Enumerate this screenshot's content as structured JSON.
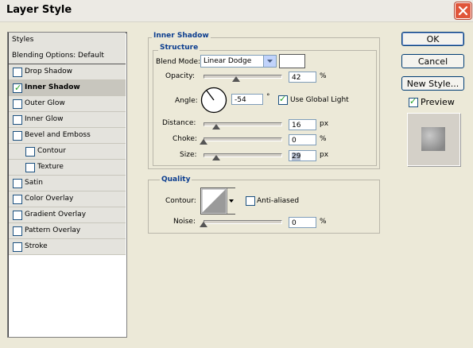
{
  "window": {
    "title": "Layer Style"
  },
  "sidebar": {
    "header": "Styles",
    "items": [
      {
        "label": "Blending Options: Default",
        "checkbox": false,
        "checked": false,
        "indent": 0
      },
      {
        "label": "Drop Shadow",
        "checkbox": true,
        "checked": false,
        "indent": 0
      },
      {
        "label": "Inner Shadow",
        "checkbox": true,
        "checked": true,
        "indent": 0,
        "selected": true
      },
      {
        "label": "Outer Glow",
        "checkbox": true,
        "checked": false,
        "indent": 0
      },
      {
        "label": "Inner Glow",
        "checkbox": true,
        "checked": false,
        "indent": 0
      },
      {
        "label": "Bevel and Emboss",
        "checkbox": true,
        "checked": false,
        "indent": 0
      },
      {
        "label": "Contour",
        "checkbox": true,
        "checked": false,
        "indent": 1
      },
      {
        "label": "Texture",
        "checkbox": true,
        "checked": false,
        "indent": 1
      },
      {
        "label": "Satin",
        "checkbox": true,
        "checked": false,
        "indent": 0
      },
      {
        "label": "Color Overlay",
        "checkbox": true,
        "checked": false,
        "indent": 0
      },
      {
        "label": "Gradient Overlay",
        "checkbox": true,
        "checked": false,
        "indent": 0
      },
      {
        "label": "Pattern Overlay",
        "checkbox": true,
        "checked": false,
        "indent": 0
      },
      {
        "label": "Stroke",
        "checkbox": true,
        "checked": false,
        "indent": 0
      }
    ]
  },
  "inner_shadow": {
    "title": "Inner Shadow",
    "structure": {
      "title": "Structure",
      "blend_mode_label": "Blend Mode:",
      "blend_mode_value": "Linear Dodge",
      "shadow_color": "#ffffff",
      "opacity_label": "Opacity:",
      "opacity_value": "42",
      "opacity_unit": "%",
      "angle_label": "Angle:",
      "angle_value": "-54",
      "angle_unit": "°",
      "use_global_light_label": "Use Global Light",
      "use_global_light_checked": true,
      "distance_label": "Distance:",
      "distance_value": "16",
      "distance_unit": "px",
      "choke_label": "Choke:",
      "choke_value": "0",
      "choke_unit": "%",
      "size_label": "Size:",
      "size_value": "29",
      "size_unit": "px"
    },
    "quality": {
      "title": "Quality",
      "contour_label": "Contour:",
      "anti_aliased_label": "Anti-aliased",
      "anti_aliased_checked": false,
      "noise_label": "Noise:",
      "noise_value": "0",
      "noise_unit": "%"
    }
  },
  "buttons": {
    "ok": "OK",
    "cancel": "Cancel",
    "new_style": "New Style..."
  },
  "preview": {
    "label": "Preview",
    "checked": true
  }
}
